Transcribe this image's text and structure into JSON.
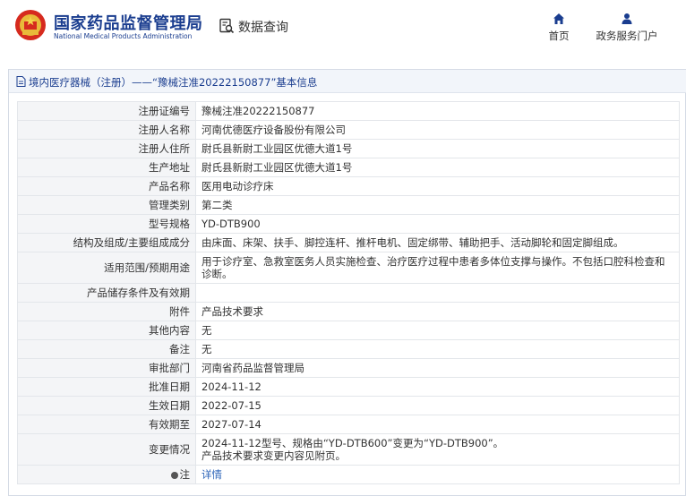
{
  "header": {
    "title_cn": "国家药品监督管理局",
    "title_en": "National Medical Products Administration",
    "query_label": "数据查询",
    "nav": [
      {
        "label": "首页",
        "icon": "home-icon"
      },
      {
        "label": "政务服务门户",
        "icon": "user-icon"
      }
    ]
  },
  "panel": {
    "title": "境内医疗器械（注册）——“豫械注准20222150877”基本信息"
  },
  "fields": [
    {
      "key": "注册证编号",
      "value": "豫械注准20222150877"
    },
    {
      "key": "注册人名称",
      "value": "河南优德医疗设备股份有限公司"
    },
    {
      "key": "注册人住所",
      "value": "尉氏县新尉工业园区优德大道1号"
    },
    {
      "key": "生产地址",
      "value": "尉氏县新尉工业园区优德大道1号"
    },
    {
      "key": "产品名称",
      "value": "医用电动诊疗床"
    },
    {
      "key": "管理类别",
      "value": "第二类"
    },
    {
      "key": "型号规格",
      "value": "YD-DTB900"
    },
    {
      "key": "结构及组成/主要组成成分",
      "value": "由床面、床架、扶手、脚控连杆、推杆电机、固定绑带、辅助把手、活动脚轮和固定脚组成。"
    },
    {
      "key": "适用范围/预期用途",
      "value": "用于诊疗室、急救室医务人员实施检查、治疗医疗过程中患者多体位支撑与操作。不包括口腔科检查和诊断。"
    },
    {
      "key": "产品储存条件及有效期",
      "value": ""
    },
    {
      "key": "附件",
      "value": "产品技术要求"
    },
    {
      "key": "其他内容",
      "value": "无"
    },
    {
      "key": "备注",
      "value": "无"
    },
    {
      "key": "审批部门",
      "value": "河南省药品监督管理局"
    },
    {
      "key": "批准日期",
      "value": "2024-11-12"
    },
    {
      "key": "生效日期",
      "value": "2022-07-15"
    },
    {
      "key": "有效期至",
      "value": "2027-07-14"
    },
    {
      "key": "变更情况",
      "value_line1": "2024-11-12型号、规格由“YD-DTB600”变更为“YD-DTB900”。",
      "value_line2": "产品技术要求变更内容见附页。"
    },
    {
      "key": "注",
      "value": "详情"
    }
  ]
}
